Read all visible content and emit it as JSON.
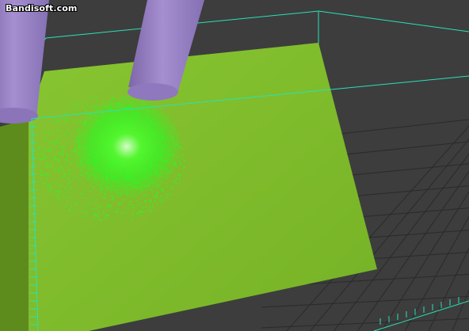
{
  "watermark": {
    "text": "Bandisoft.com"
  },
  "scene": {
    "background_color": "#3d3d3d",
    "grid_color": "#2a2a2a",
    "plane_color": "#7fba2a",
    "plane_shadow_color": "#5c8a1c",
    "bounding_box_color": "#27e3b4",
    "emitter_color": "#9a82c4",
    "particle_color": "#22ff22",
    "objects": [
      "floor-grid",
      "tilted-plane",
      "emitter-cylinder-left",
      "emitter-cylinder-right",
      "particle-cloud",
      "bounding-box"
    ]
  }
}
